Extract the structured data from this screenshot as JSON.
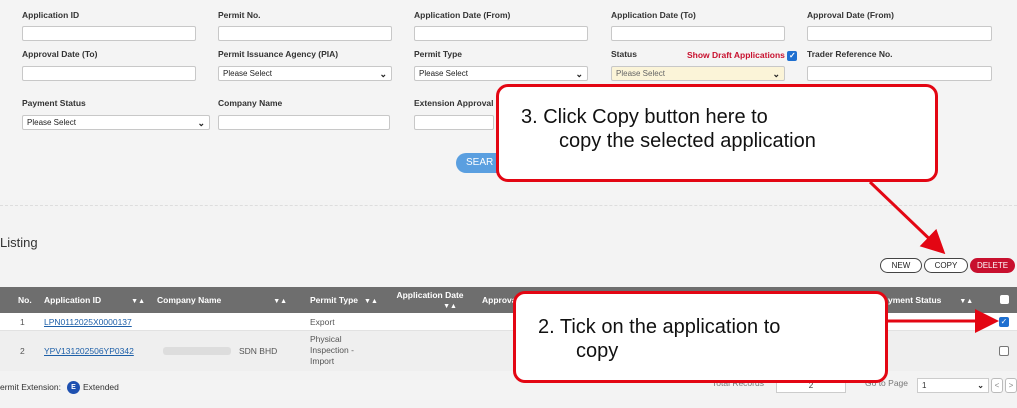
{
  "filters": {
    "application_id": "Application ID",
    "permit_no": "Permit No.",
    "app_date_from": "Application Date (From)",
    "app_date_to": "Application Date (To)",
    "approval_date_from": "Approval Date (From)",
    "approval_date_to": "Approval Date (To)",
    "pia": "Permit Issuance Agency (PIA)",
    "permit_type": "Permit Type",
    "status": "Status",
    "show_draft": "Show Draft Applications",
    "trader_ref": "Trader Reference No.",
    "payment_status": "Payment Status",
    "company_name": "Company Name",
    "extension_approval": "Extension Approval",
    "please_select": "Please Select",
    "search_button": "SEAR"
  },
  "listing": {
    "title": "Listing",
    "new_button": "NEW",
    "copy_button": "COPY",
    "delete_button": "DELETE",
    "columns": {
      "no": "No.",
      "application_id": "Application ID",
      "company_name": "Company Name",
      "permit_type": "Permit Type",
      "application_date": "Application Date",
      "approval": "Approva",
      "payment_status": "yment Status"
    },
    "rows": [
      {
        "no": "1",
        "application_id": "LPN0112025X0000137",
        "company_name": "",
        "permit_type": "Export",
        "checked": true
      },
      {
        "no": "2",
        "application_id": "YPV131202506YP0342",
        "company_name": "SDN BHD",
        "permit_type": "Physical Inspection - Import",
        "checked": false
      }
    ]
  },
  "footer": {
    "permit_extension": "ermit Extension:",
    "badge": "E",
    "extended": "Extended",
    "total_records_label": "Total Records",
    "total_records": "2",
    "goto_page": "Go to Page",
    "page": "1"
  },
  "annotations": {
    "step3_line1": "3.  Click Copy button here to",
    "step3_line2": "copy the selected application",
    "step2_line1": "2.  Tick on the application to",
    "step2_line2": "copy"
  },
  "colors": {
    "accent_red": "#e30613",
    "header_gray": "#6e6e6e",
    "link_blue": "#1d5fa8",
    "delete_red": "#c8102e"
  }
}
